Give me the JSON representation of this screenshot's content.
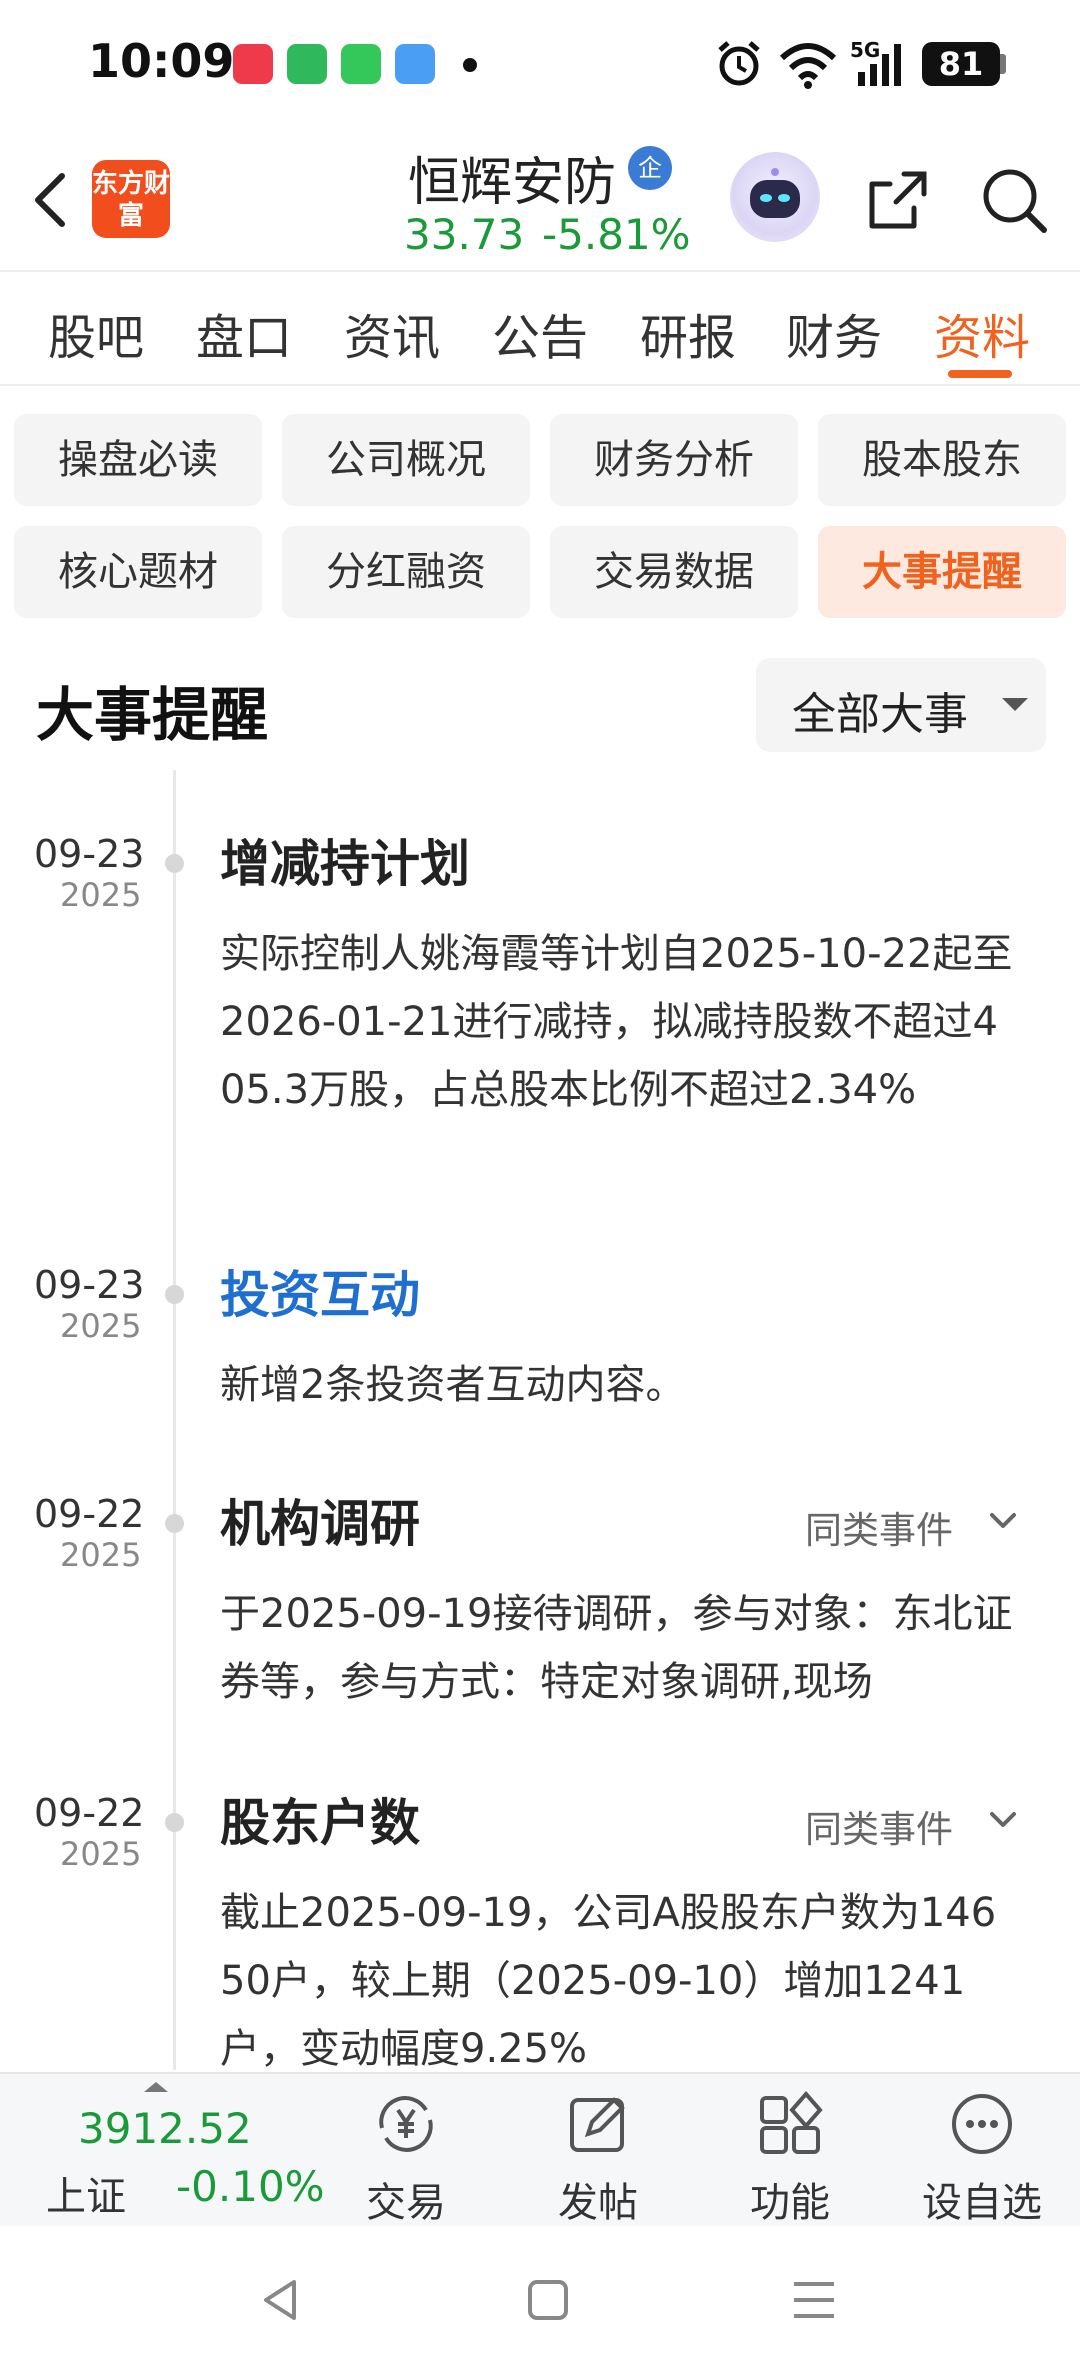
{
  "status_bar": {
    "time": "10:09",
    "network": "5G",
    "battery": "81",
    "app_icons": [
      "xiaohongshu-icon",
      "grid-app-icon",
      "messages-icon",
      "weather-icon"
    ],
    "app_icon_colors": [
      "#ee3a4a",
      "#2fb85c",
      "#34c759",
      "#4a9ff5"
    ]
  },
  "header": {
    "logo_text": "东方财富",
    "stock_name": "恒辉安防",
    "stock_badge": "企",
    "price": "33.73",
    "change_pct": "-5.81%",
    "up_down_color": "#1a9a39"
  },
  "tabs": [
    {
      "label": "股吧",
      "active": false
    },
    {
      "label": "盘口",
      "active": false
    },
    {
      "label": "资讯",
      "active": false
    },
    {
      "label": "公告",
      "active": false
    },
    {
      "label": "研报",
      "active": false
    },
    {
      "label": "财务",
      "active": false
    },
    {
      "label": "资料",
      "active": true
    }
  ],
  "accent_color": "#f0621d",
  "categories": [
    {
      "label": "操盘必读",
      "active": false
    },
    {
      "label": "公司概况",
      "active": false
    },
    {
      "label": "财务分析",
      "active": false
    },
    {
      "label": "股本股东",
      "active": false
    },
    {
      "label": "核心题材",
      "active": false
    },
    {
      "label": "分红融资",
      "active": false
    },
    {
      "label": "交易数据",
      "active": false
    },
    {
      "label": "大事提醒",
      "active": true
    }
  ],
  "section": {
    "title": "大事提醒",
    "filter_label": "全部大事"
  },
  "events": [
    {
      "date": "09-23",
      "year": "2025",
      "title": "增减持计划",
      "title_is_link": false,
      "body": "实际控制人姚海霞等计划自2025-10-22起至2026-01-21进行减持，拟减持股数不超过405.3万股，占总股本比例不超过2.34%",
      "similar_label": ""
    },
    {
      "date": "09-23",
      "year": "2025",
      "title": "投资互动",
      "title_is_link": true,
      "body": "新增2条投资者互动内容。",
      "similar_label": ""
    },
    {
      "date": "09-22",
      "year": "2025",
      "title": "机构调研",
      "title_is_link": false,
      "body": "于2025-09-19接待调研，参与对象：东北证券等，参与方式：特定对象调研,现场",
      "similar_label": "同类事件"
    },
    {
      "date": "09-22",
      "year": "2025",
      "title": "股东户数",
      "title_is_link": false,
      "body": "截止2025-09-19，公司A股股东户数为14650户，较上期（2025-09-10）增加1241户，变动幅度9.25%",
      "similar_label": "同类事件"
    }
  ],
  "bottom_bar": {
    "index_value": "3912.52",
    "index_name": "上证",
    "index_change": "-0.10%",
    "nav": [
      {
        "label": "交易",
        "icon": "yen-exchange-icon"
      },
      {
        "label": "发帖",
        "icon": "edit-post-icon"
      },
      {
        "label": "功能",
        "icon": "grid-functions-icon"
      },
      {
        "label": "设自选",
        "icon": "more-dots-icon"
      }
    ]
  }
}
